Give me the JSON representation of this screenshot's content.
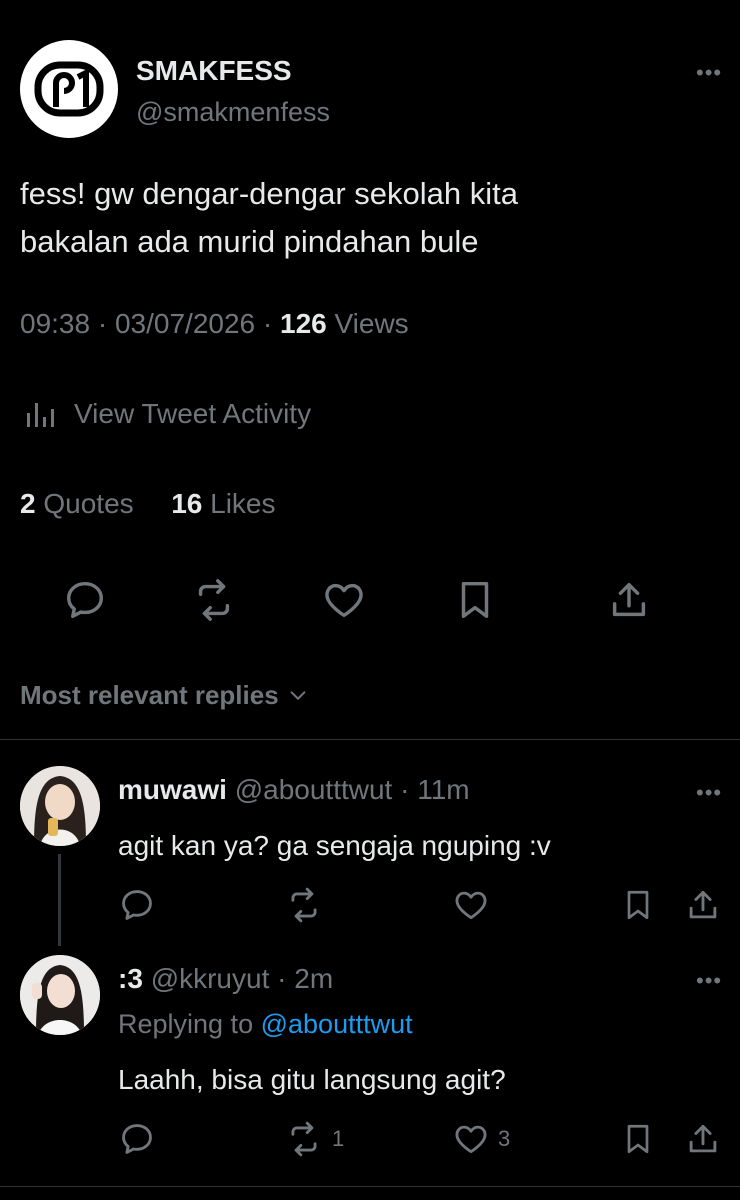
{
  "tweet": {
    "display_name": "SMAKFESS",
    "handle": "@smakmenfess",
    "text_line1": "fess! gw dengar-dengar sekolah kita",
    "text_line2": "bakalan ada murid pindahan bule",
    "time": "09:38",
    "date": "03/07/2026",
    "views_count": "126",
    "views_label": "Views",
    "activity_label": "View Tweet Activity",
    "quotes_count": "2",
    "quotes_label": "Quotes",
    "likes_count": "16",
    "likes_label": "Likes"
  },
  "replies_sort_label": "Most relevant replies",
  "replies": [
    {
      "name": "muwawi",
      "handle": "@aboutttwut",
      "time": "11m",
      "text": "agit kan ya? ga sengaja nguping :v"
    },
    {
      "name": ":3",
      "handle": "@kkruyut",
      "time": "2m",
      "replying_prefix": "Replying to",
      "replying_handle": "@aboutttwut",
      "text": "Laahh, bisa gitu langsung agit?",
      "retweet_count": "1",
      "like_count": "3"
    }
  ],
  "colors": {
    "background": "#000000",
    "text": "#e7e9ea",
    "secondary": "#71767b",
    "link": "#1d9bf0"
  },
  "icons": [
    "more-icon",
    "reply-icon",
    "retweet-icon",
    "like-icon",
    "bookmark-icon",
    "share-icon",
    "analytics-icon",
    "chevron-down-icon"
  ]
}
